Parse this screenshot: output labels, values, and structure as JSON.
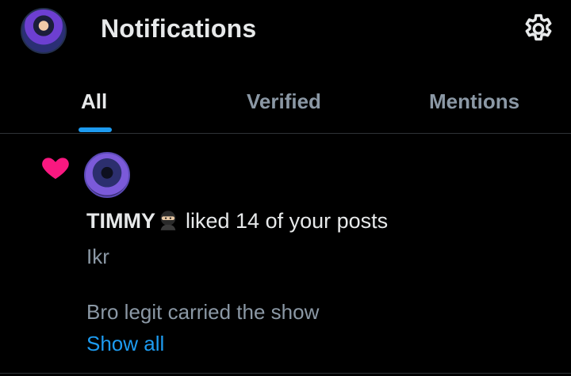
{
  "header": {
    "title": "Notifications",
    "avatar_icon": "user-avatar-icon",
    "settings_icon": "gear-icon"
  },
  "tabs": [
    {
      "label": "All",
      "active": true
    },
    {
      "label": "Verified",
      "active": false
    },
    {
      "label": "Mentions",
      "active": false
    }
  ],
  "notification": {
    "type_icon": "heart-icon",
    "user_name": "TIMMY",
    "name_emoji_icon": "ninja-emoji-icon",
    "action_text": "liked 14 of your posts",
    "snippets": [
      "Ikr",
      "Bro legit carried the show"
    ],
    "show_all_label": "Show all"
  },
  "colors": {
    "background": "#000000",
    "accent": "#1d9bf0",
    "like": "#f91880",
    "primary_text": "#e7e9ea",
    "secondary_text": "#8b98a5"
  }
}
